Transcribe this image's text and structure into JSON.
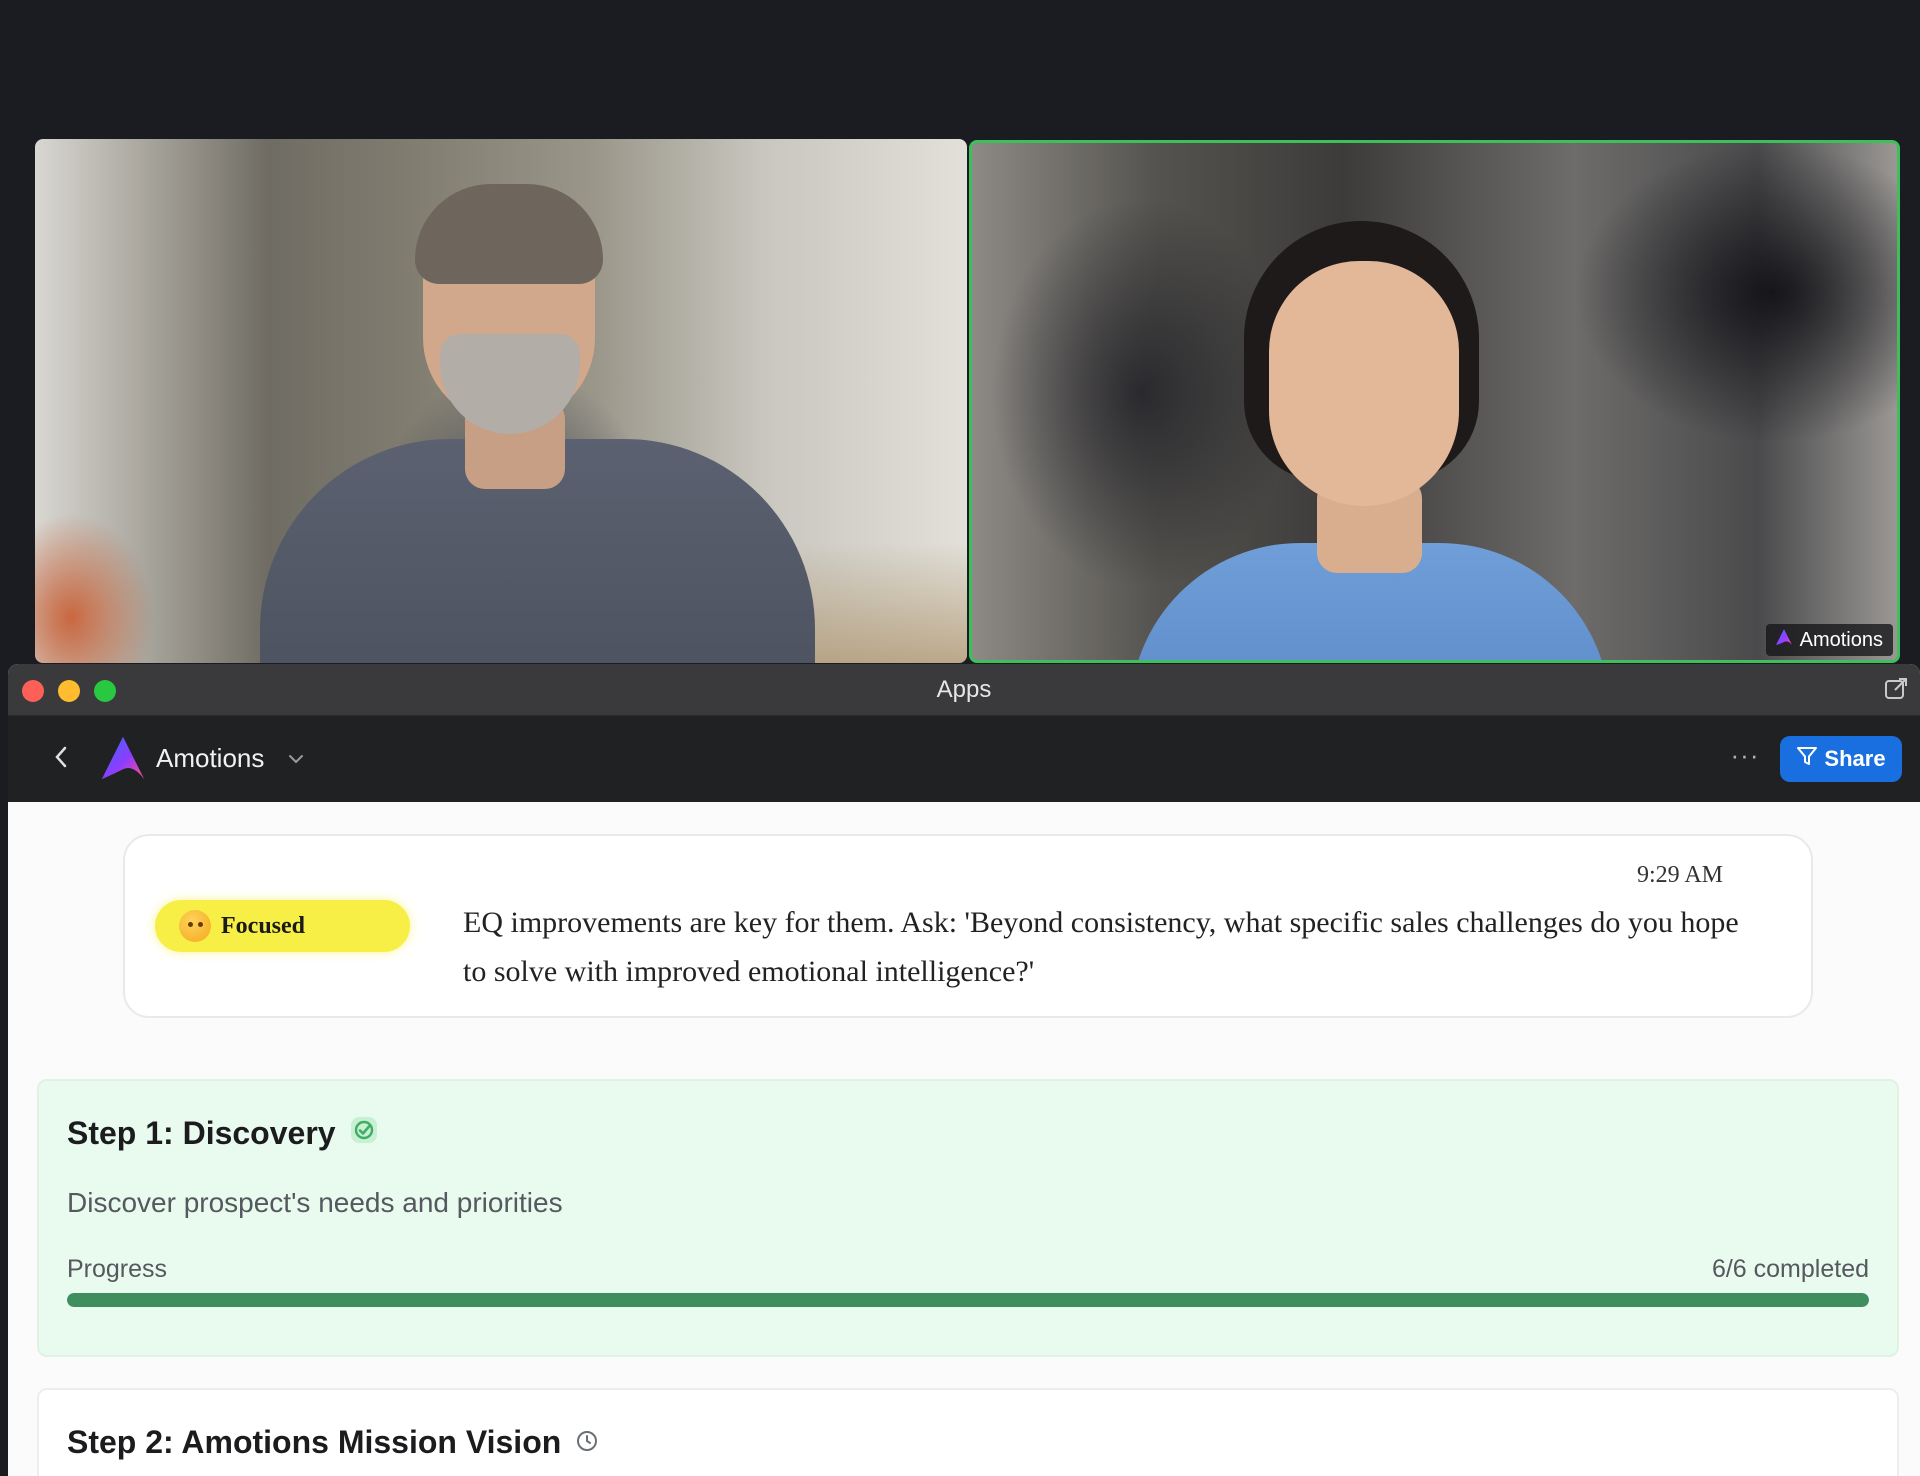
{
  "meeting": {
    "participant_tag": {
      "label": "Amotions",
      "icon": "amotions-logo-icon"
    },
    "active_speaker_color": "#3fbf5c"
  },
  "window": {
    "title": "Apps",
    "controls": [
      "close",
      "minimize",
      "zoom"
    ],
    "popout_icon": "popout-icon"
  },
  "toolbar": {
    "back_icon": "chevron-left-icon",
    "app_name": "Amotions",
    "dropdown_icon": "chevron-down-icon",
    "more_label": "···",
    "share_label": "Share",
    "share_icon": "filter-icon",
    "share_color": "#1a6fe0"
  },
  "insight": {
    "time": "9:29 AM",
    "mood": "Focused",
    "mood_color": "#f7ef46",
    "message": "EQ improvements are key for them. Ask: 'Beyond consistency, what specific sales challenges do you hope to solve with improved emotional intelligence?'"
  },
  "steps": [
    {
      "title": "Step 1: Discovery",
      "status_icon": "check-circle-icon",
      "description": "Discover prospect's needs and priorities",
      "progress_label": "Progress",
      "progress_text": "6/6 completed",
      "progress_fraction": 1.0,
      "progress_color": "#3f8f5e"
    },
    {
      "title": "Step 2: Amotions Mission Vision",
      "status_icon": "clock-icon"
    }
  ]
}
